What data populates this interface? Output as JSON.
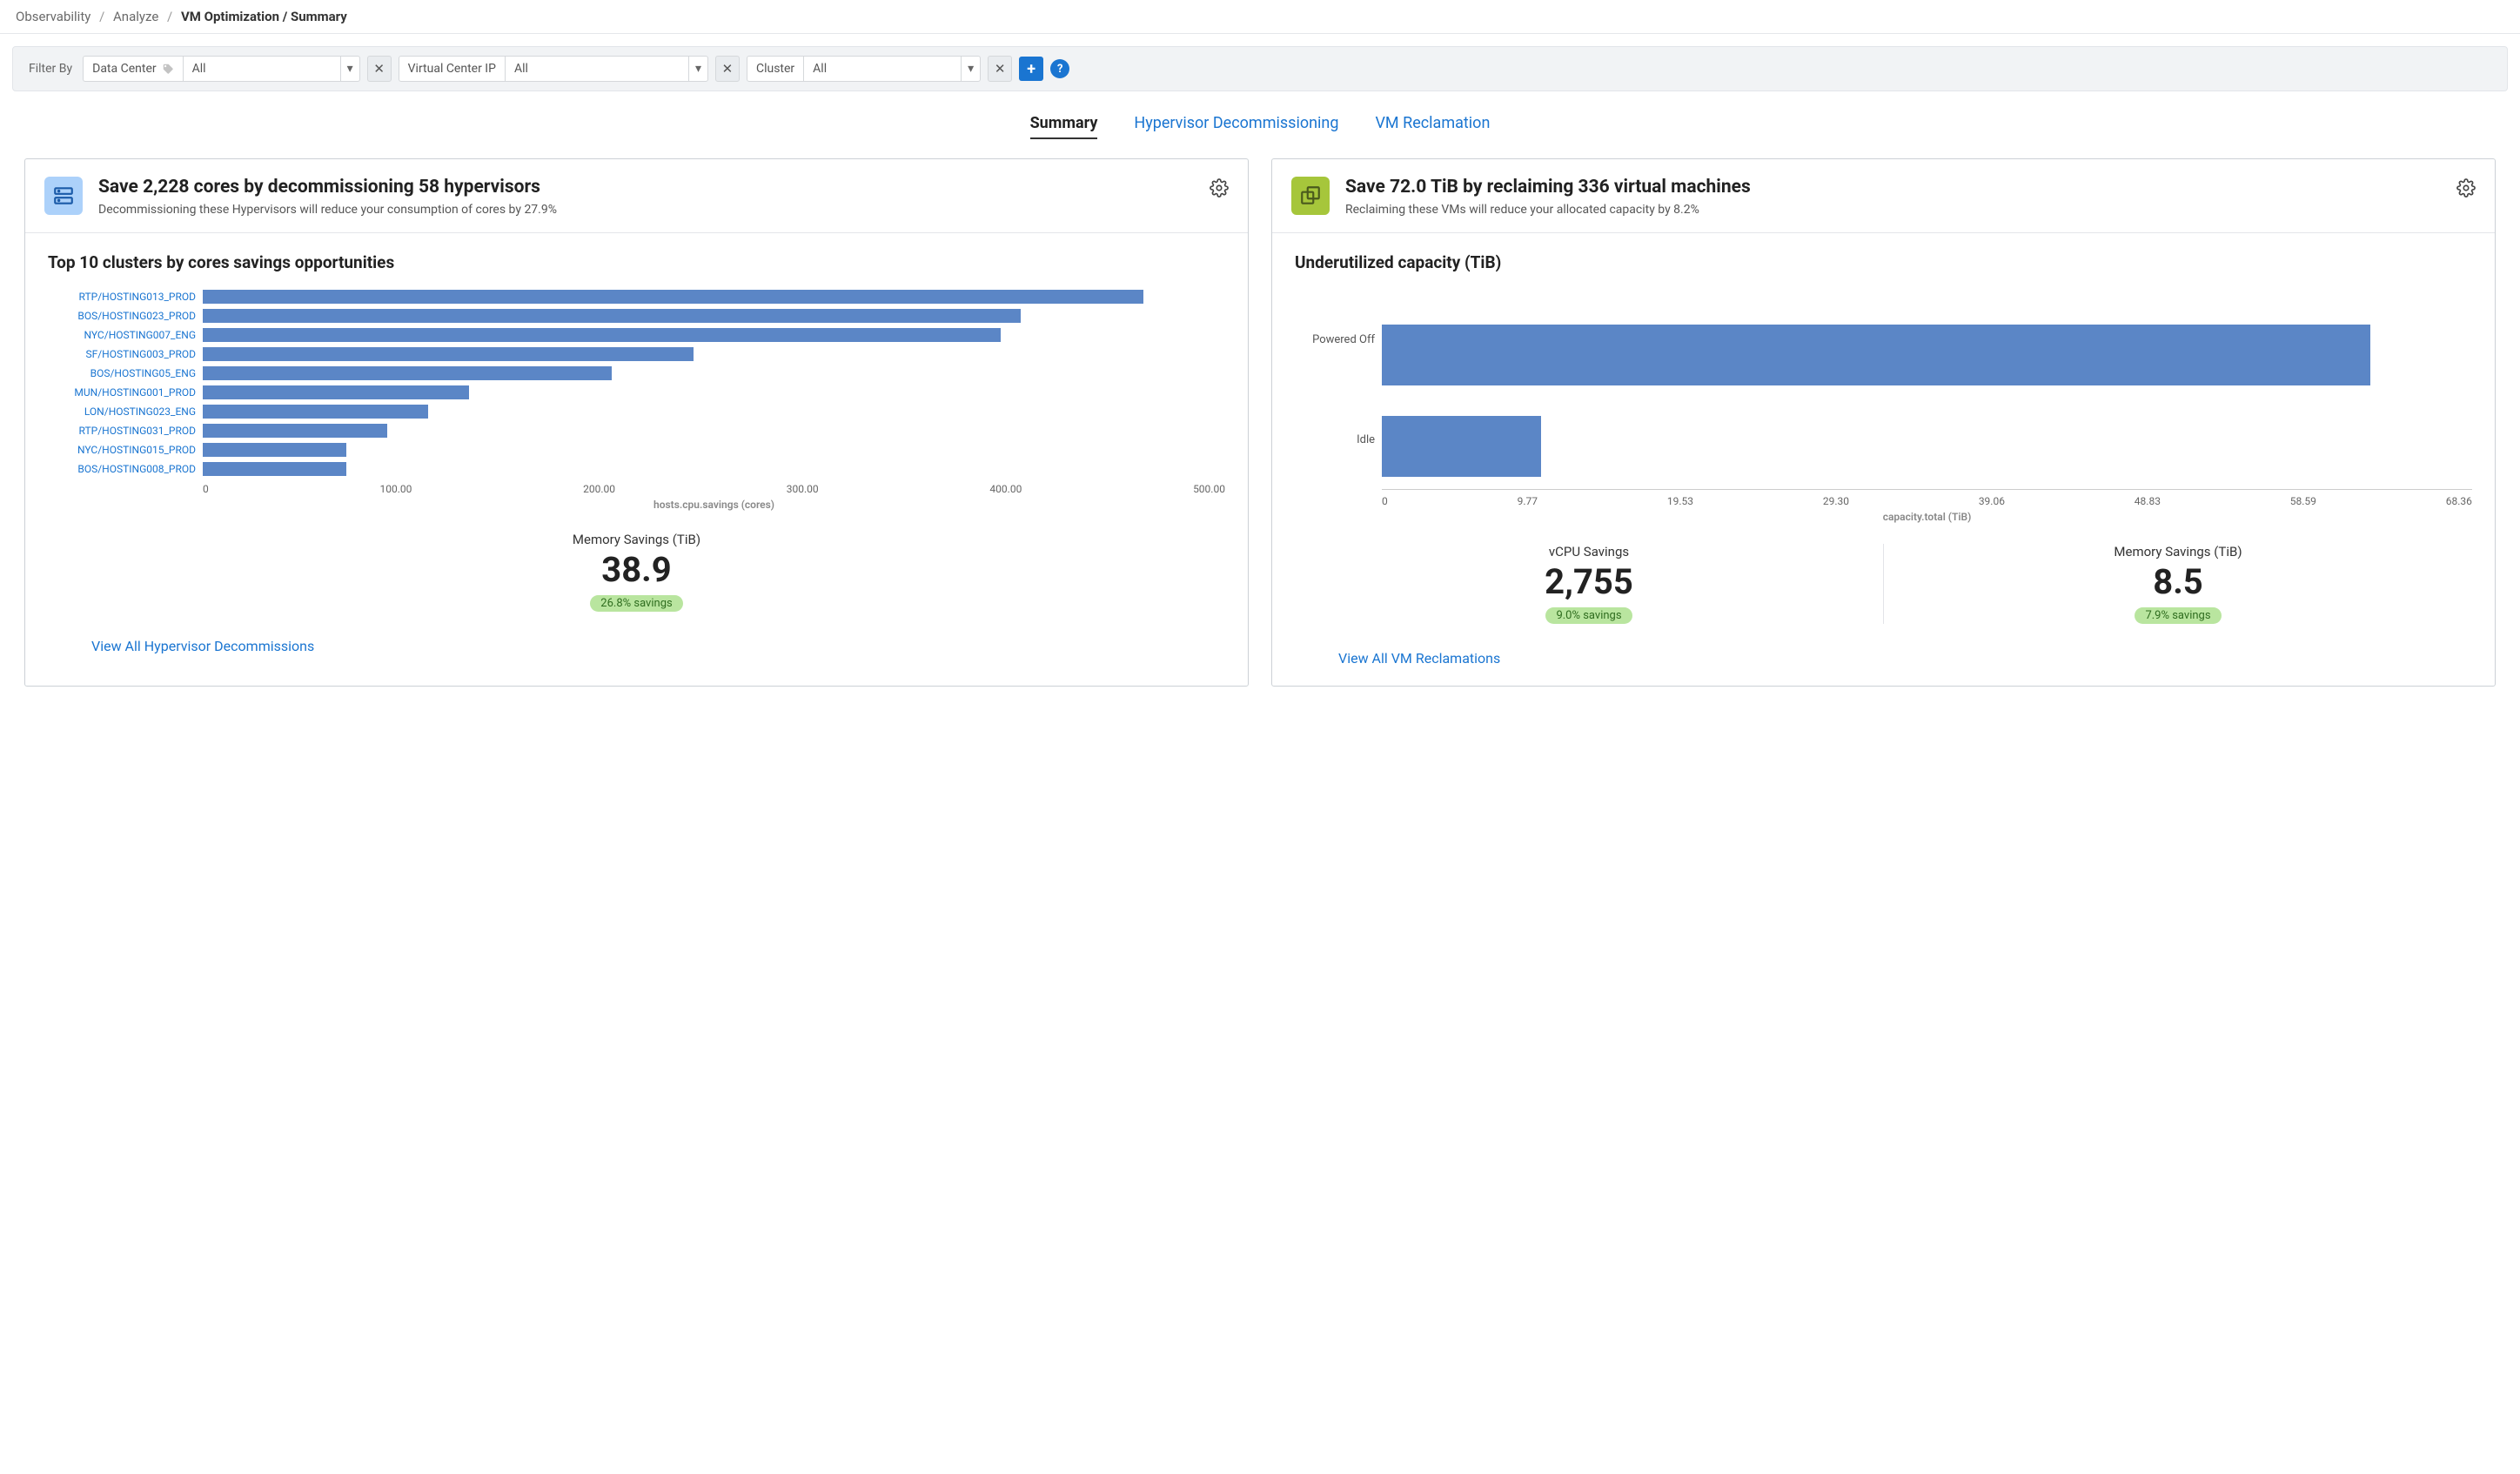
{
  "breadcrumb": {
    "a": "Observability",
    "b": "Analyze",
    "c": "VM Optimization / Summary"
  },
  "filters": {
    "label": "Filter By",
    "dc_label": "Data Center",
    "dc_value": "All",
    "vc_label": "Virtual Center IP",
    "vc_value": "All",
    "cl_label": "Cluster",
    "cl_value": "All"
  },
  "tabs": {
    "summary": "Summary",
    "hyper": "Hypervisor Decommissioning",
    "vm": "VM Reclamation"
  },
  "panelA": {
    "title": "Save 2,228 cores by decommissioning 58 hypervisors",
    "sub": "Decommissioning these Hypervisors will reduce your consumption of cores by 27.9%",
    "chart_title": "Top 10 clusters by cores savings opportunities",
    "stat_label": "Memory Savings (TiB)",
    "stat_value": "38.9",
    "stat_pill": "26.8% savings",
    "link": "View All Hypervisor Decommissions"
  },
  "panelB": {
    "title": "Save 72.0 TiB by reclaiming 336 virtual machines",
    "sub": "Reclaiming these VMs will reduce your allocated capacity by 8.2%",
    "chart_title": "Underutilized capacity (TiB)",
    "stat1_label": "vCPU Savings",
    "stat1_value": "2,755",
    "stat1_pill": "9.0% savings",
    "stat2_label": "Memory Savings (TiB)",
    "stat2_value": "8.5",
    "stat2_pill": "7.9% savings",
    "link": "View All VM Reclamations"
  },
  "chart_data": [
    {
      "type": "bar",
      "orientation": "horizontal",
      "title": "Top 10 clusters by cores savings opportunities",
      "xlabel": "hosts.cpu.savings (cores)",
      "ylabel": "",
      "xlim": [
        0,
        500
      ],
      "xticks": [
        "0",
        "100.00",
        "200.00",
        "300.00",
        "400.00",
        "500.00"
      ],
      "categories": [
        "RTP/HOSTING013_PROD",
        "BOS/HOSTING023_PROD",
        "NYC/HOSTING007_ENG",
        "SF/HOSTING003_PROD",
        "BOS/HOSTING05_ENG",
        "MUN/HOSTING001_PROD",
        "LON/HOSTING023_ENG",
        "RTP/HOSTING031_PROD",
        "NYC/HOSTING015_PROD",
        "BOS/HOSTING008_PROD"
      ],
      "values": [
        460,
        400,
        390,
        240,
        200,
        130,
        110,
        90,
        70,
        70
      ]
    },
    {
      "type": "bar",
      "orientation": "horizontal",
      "title": "Underutilized capacity (TiB)",
      "xlabel": "capacity.total (TiB)",
      "ylabel": "",
      "xlim": [
        0,
        68.36
      ],
      "xticks": [
        "0",
        "9.77",
        "19.53",
        "29.30",
        "39.06",
        "48.83",
        "58.59",
        "68.36"
      ],
      "categories": [
        "Powered Off",
        "Idle"
      ],
      "values": [
        62,
        10
      ]
    }
  ]
}
